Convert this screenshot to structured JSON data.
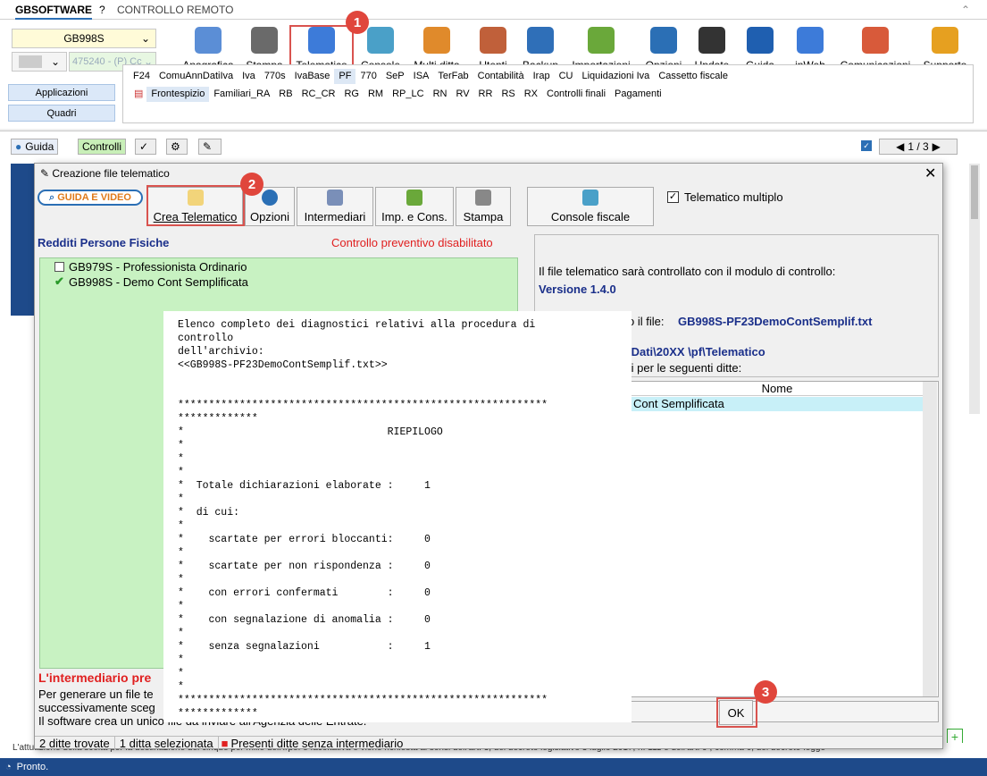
{
  "top_tabs": [
    "GBSOFTWARE",
    "?",
    "CONTROLLO REMOTO"
  ],
  "company_combo": "GB998S",
  "user_combo": "475240 - (P) Cc",
  "toolbar": [
    {
      "label": "Anagrafica",
      "icon": "person-card-icon",
      "color": "#5b8ed6"
    },
    {
      "label": "Stampa",
      "icon": "printer-icon",
      "color": "#6a6a6a"
    },
    {
      "label": "Telematico",
      "icon": "document-icon",
      "color": "#3d7bd9"
    },
    {
      "label": "Console",
      "icon": "monitor-icon",
      "color": "#4aa0c8"
    },
    {
      "label": "Multi ditta",
      "icon": "org-chart-icon",
      "color": "#e08a2b"
    },
    {
      "label": "Utenti",
      "icon": "users-icon",
      "color": "#c0603a"
    },
    {
      "label": "Backup",
      "icon": "disk-icon",
      "color": "#2f6fb8"
    },
    {
      "label": "Importazioni",
      "icon": "import-icon",
      "color": "#6aa83a"
    },
    {
      "label": "Opzioni",
      "icon": "gear-icon",
      "color": "#2b6fb5"
    },
    {
      "label": "Update",
      "icon": "pulse-monitor-icon",
      "color": "#333333"
    },
    {
      "label": "Guida",
      "icon": "help-icon",
      "color": "#1f5fb0"
    },
    {
      "label": "inWeb",
      "icon": "cloud-icon",
      "color": "#3d7bd9"
    },
    {
      "label": "Comunicazioni",
      "icon": "megaphone-icon",
      "color": "#d85a3a"
    },
    {
      "label": "Supporto",
      "icon": "support-icon",
      "color": "#e6a020"
    }
  ],
  "side_buttons": [
    "Applicazioni",
    "Quadri"
  ],
  "menu_row1": [
    "F24",
    "ComuAnnDatiIva",
    "Iva",
    "770s",
    "IvaBase",
    "PF",
    "770",
    "SeP",
    "ISA",
    "TerFab",
    "Contabilità",
    "Irap",
    "CU",
    "Liquidazioni Iva",
    "Cassetto fiscale"
  ],
  "menu_row2": [
    "Frontespizio",
    "Familiari_RA",
    "RB",
    "RC_CR",
    "RG",
    "RM",
    "RP_LC",
    "RN",
    "RV",
    "RR",
    "RS",
    "RX",
    "Controlli finali",
    "Pagamenti"
  ],
  "lower_toolbar": {
    "guida": "Guida",
    "controlli": "Controlli",
    "pager": "1 / 3"
  },
  "dialog": {
    "title": "Creazione file telematico",
    "guide_button": "GUIDA E VIDEO",
    "buttons": [
      "Crea Telematico",
      "Opzioni",
      "Intermediari",
      "Imp. e Cons.",
      "Stampa"
    ],
    "console_button": "Console fiscale",
    "multi_label": "Telematico multiplo",
    "section_title": "Redditi Persone Fisiche",
    "control_status": "Controllo preventivo disabilitato",
    "companies": [
      {
        "label": "GB979S - Professionista Ordinario",
        "checked": false
      },
      {
        "label": "GB998S - Demo Cont Semplificata",
        "checked": true
      }
    ],
    "info_line1": "Il file telematico sarà controllato con il modulo di controllo:",
    "version": "Versione 1.4.0",
    "file_prefix": "o il file:",
    "file_name": "GB998S-PF23DemoContSemplif.txt",
    "path": "\\Dati\\20XX \\pf\\Telematico",
    "ditte_text": "ti per le seguenti ditte:",
    "table_header": "Nome",
    "table_row": "Cont Semplificata",
    "warning_title": "L'intermediario pre",
    "help_lines": [
      "Per generare un file te",
      "successivamente sceg",
      "Il software crea un unico file da inviare all'Agenzia delle Entrate."
    ],
    "ok_button": "OK"
  },
  "diagnostics": "Elenco completo dei diagnostici relativi alla procedura di\ncontrollo\ndell'archivio:\n<<GB998S-PF23DemoContSemplif.txt>>\n\n\n************************************************************\n*************\n*                                 RIEPILOGO\n*\n*\n*\n*  Totale dichiarazioni elaborate :     1\n*\n*  di cui:\n*\n*    scartate per errori bloccanti:     0\n*\n*    scartate per non rispondenza :     0\n*\n*    con errori confermati        :     0\n*\n*    con segnalazione di anomalia :     0\n*\n*    senza segnalazioni           :     1\n*\n*\n*\n************************************************************\n*************",
  "footer": {
    "count": "2 ditte trovate",
    "selected": "1 ditta selezionata",
    "warning": "Presenti ditte senza intermediario"
  },
  "marquee": "L'attuazione della scelta per la destinazione del cinque per mille dell'Irpef è facoltativa e viene richiesta ai sensi dell'art. 3, del decreto legislativo 3 luglio 2017, n. 111 e dell'art. 9 , comma 6, del decreto-legge",
  "status": "Pronto.",
  "badges": [
    "1",
    "2",
    "3"
  ]
}
